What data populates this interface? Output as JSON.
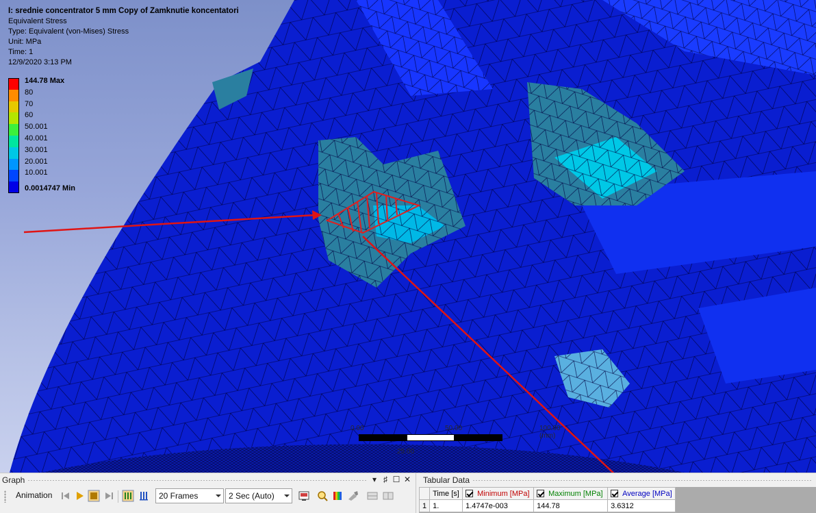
{
  "result": {
    "title": "I: srednie concentrator 5 mm Copy of Zamknutie koncentatori",
    "lines": [
      "Equivalent Stress",
      "Type: Equivalent (von-Mises) Stress",
      "Unit: MPa",
      "Time: 1",
      "12/9/2020 3:13 PM"
    ]
  },
  "legend": {
    "max_label": "144.78 Max",
    "min_label": "0.0014747 Min",
    "levels": [
      "80",
      "70",
      "60",
      "50.001",
      "40.001",
      "30.001",
      "20.001",
      "10.001"
    ],
    "colors": [
      "#ff0000",
      "#ff8c00",
      "#e6c800",
      "#b4e600",
      "#3cf03c",
      "#00e6a0",
      "#00c8e6",
      "#0096ff",
      "#0046ff",
      "#0000e6"
    ]
  },
  "scale": {
    "label_0": "0.00",
    "label_50": "50.00",
    "label_100": "100.00 (mm)",
    "label_25": "25.00"
  },
  "graph": {
    "title": "Graph",
    "header_buttons": [
      "▾",
      "♯",
      "☐",
      "✕"
    ],
    "animation_label": "Animation",
    "frames": "20 Frames",
    "speed": "2 Sec (Auto)"
  },
  "tabular": {
    "title": "Tabular Data",
    "columns": [
      "Time [s]",
      "Minimum [MPa]",
      "Maximum [MPa]",
      "Average [MPa]"
    ],
    "column_colors": [
      "#000000",
      "#c00000",
      "#008000",
      "#0000c0"
    ],
    "rows": [
      {
        "index": "1",
        "time": "1.",
        "min": "1.4747e-003",
        "max": "144.78",
        "avg": "3.6312"
      }
    ]
  }
}
